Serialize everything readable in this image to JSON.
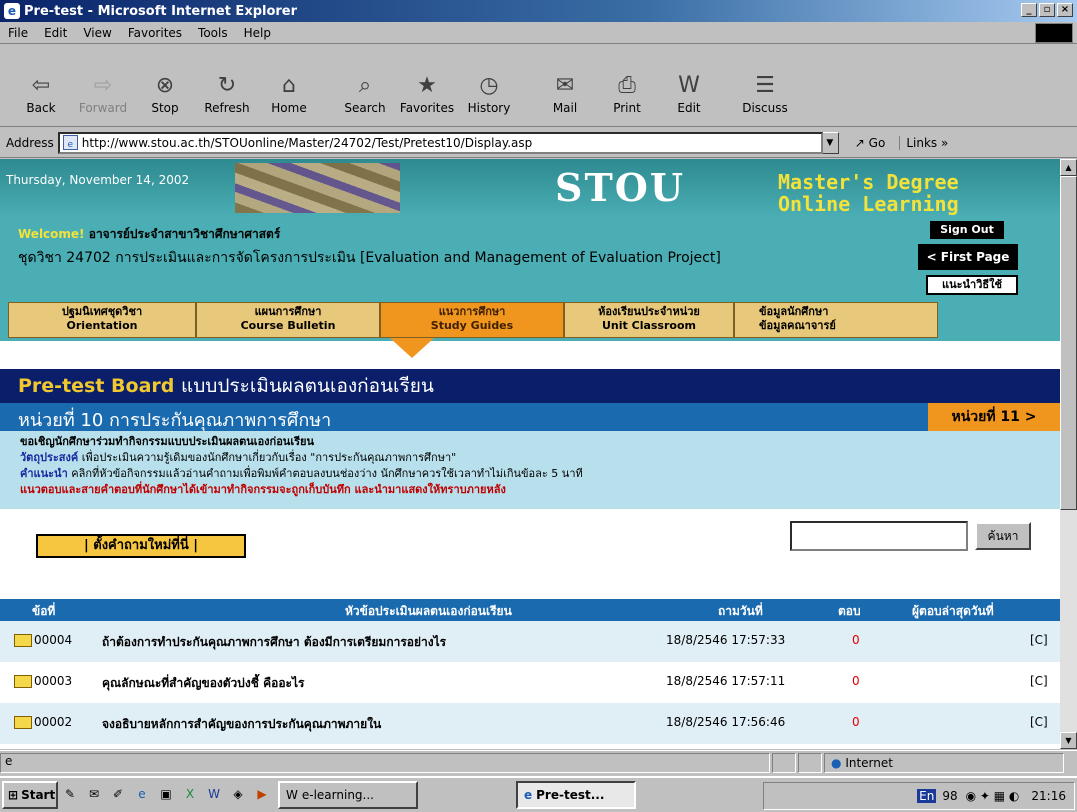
{
  "window": {
    "title": "Pre-test - Microsoft Internet Explorer"
  },
  "menu": [
    "File",
    "Edit",
    "View",
    "Favorites",
    "Tools",
    "Help"
  ],
  "toolbar": {
    "back": "Back",
    "forward": "Forward",
    "stop": "Stop",
    "refresh": "Refresh",
    "home": "Home",
    "search": "Search",
    "favorites": "Favorites",
    "history": "History",
    "mail": "Mail",
    "print": "Print",
    "edit": "Edit",
    "discuss": "Discuss"
  },
  "address": {
    "label": "Address",
    "url": "http://www.stou.ac.th/STOUonline/Master/24702/Test/Pretest10/Display.asp",
    "go": "Go",
    "links": "Links"
  },
  "header": {
    "date": "Thursday, November 14, 2002",
    "logo": "STOU",
    "logo_line1": "Master's Degree",
    "logo_line2": "Online Learning",
    "welcome_prefix": "Welcome!",
    "welcome_name": "อาจารย์ประจำสาขาวิชาศึกษาศาสตร์",
    "course": "ชุดวิชา 24702 การประเมินและการจัดโครงการประเมิน [Evaluation and Management of Evaluation Project]",
    "sign_out": "Sign Out",
    "first_page": "< First Page",
    "manual": "แนะนำวิธีใช้"
  },
  "nav": [
    {
      "th": "ปฐมนิเทศชุดวิชา",
      "en": "Orientation"
    },
    {
      "th": "แผนการศึกษา",
      "en": "Course Bulletin"
    },
    {
      "th": "แนวการศึกษา",
      "en": "Study Guides"
    },
    {
      "th": "ห้องเรียนประจำหน่วย",
      "en": "Unit Classroom"
    },
    {
      "th": "ข้อมูลนักศึกษา",
      "en": "ข้อมูลคณาจารย์"
    }
  ],
  "board": {
    "title_en": "Pre-test Board",
    "title_th": "แบบประเมินผลตนเองก่อนเรียน",
    "unit": "หน่วยที่ 10 การประกันคุณภาพการศึกษา",
    "next_unit": "หน่วยที่ 11 >",
    "info1": "ขอเชิญนักศึกษาร่วมทำกิจกรรมแบบประเมินผลตนเองก่อนเรียน",
    "info2_label": "วัตถุประสงค์",
    "info2": "เพื่อประเมินความรู้เดิมของนักศึกษาเกี่ยวกับเรื่อง \"การประกันคุณภาพการศึกษา\"",
    "info3_label": "คำแนะนำ",
    "info3": "คลิกที่หัวข้อกิจกรรมแล้วอ่านคำถามเพื่อพิมพ์คำตอบลงบนช่องว่าง นักศึกษาควรใช้เวลาทำไม่เกินข้อละ 5 นาที",
    "info4": "แนวตอบและสายคำตอบที่นักศึกษาได้เข้ามาทำกิจกรรมจะถูกเก็บบันทึก และนำมาแสดงให้ทราบภายหลัง",
    "ask": "| ตั้งคำถามใหม่ที่นี่ |",
    "search_btn": "ค้นหา"
  },
  "table": {
    "headers": [
      "ข้อที่",
      "หัวข้อประเมินผลตนเองก่อนเรียน",
      "ถามวันที่",
      "ตอบ",
      "ผู้ตอบล่าสุดวันที่"
    ],
    "rows": [
      {
        "id": "00004",
        "topic": "ถ้าต้องการทำประกันคุณภาพการศึกษา ต้องมีการเตรียมการอย่างไร",
        "date": "18/8/2546 17:57:33",
        "replies": "0",
        "last": "[C]"
      },
      {
        "id": "00003",
        "topic": "คุณลักษณะที่สำคัญของตัวบ่งชี้ คืออะไร",
        "date": "18/8/2546 17:57:11",
        "replies": "0",
        "last": "[C]"
      },
      {
        "id": "00002",
        "topic": "จงอธิบายหลักการสำคัญของการประกันคุณภาพภายใน",
        "date": "18/8/2546 17:56:46",
        "replies": "0",
        "last": "[C]"
      }
    ]
  },
  "status": {
    "zone": "Internet"
  },
  "taskbar": {
    "start": "Start",
    "tasks": [
      "e-learning...",
      "Pre-test..."
    ],
    "tray_lang": "En",
    "tray_num": "98",
    "clock": "21:16"
  }
}
